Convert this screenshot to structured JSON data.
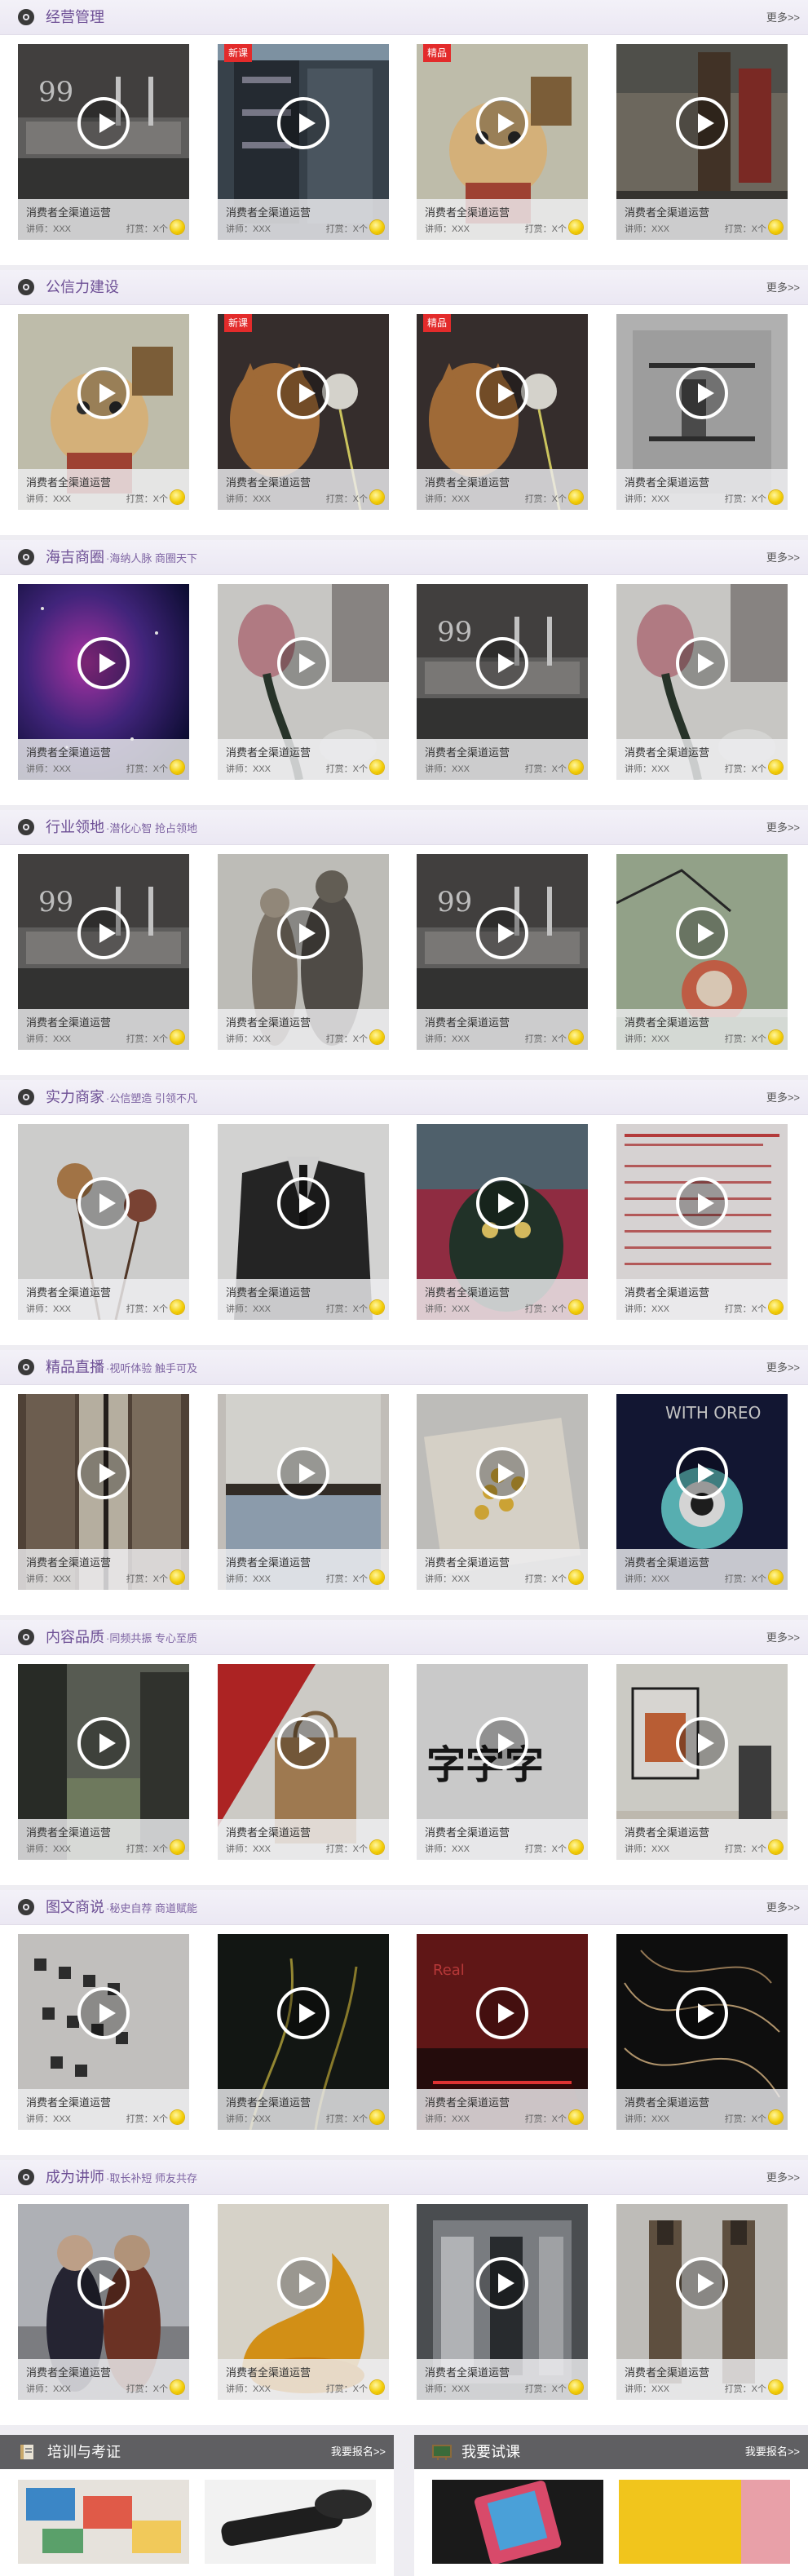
{
  "sections": [
    {
      "title": "经营管理",
      "subtitle": "",
      "more": "更多>>",
      "cards": [
        {
          "title": "消费者全渠道运营",
          "lecturer": "讲师：XXX",
          "tip": "打赏：X个",
          "tag": "",
          "theme": "interior"
        },
        {
          "title": "消费者全渠道运营",
          "lecturer": "讲师：XXX",
          "tip": "打赏：X个",
          "tag": "新课",
          "theme": "building"
        },
        {
          "title": "消费者全渠道运营",
          "lecturer": "讲师：XXX",
          "tip": "打赏：X个",
          "tag": "精品",
          "theme": "cartoon"
        },
        {
          "title": "消费者全渠道运营",
          "lecturer": "讲师：XXX",
          "tip": "打赏：X个",
          "tag": "",
          "theme": "ruin"
        }
      ]
    },
    {
      "title": "公信力建设",
      "subtitle": "",
      "more": "更多>>",
      "cards": [
        {
          "title": "消费者全渠道运营",
          "lecturer": "讲师：XXX",
          "tip": "打赏：X个",
          "tag": "",
          "theme": "cartoon"
        },
        {
          "title": "消费者全渠道运营",
          "lecturer": "讲师：XXX",
          "tip": "打赏：X个",
          "tag": "新课",
          "theme": "cat"
        },
        {
          "title": "消费者全渠道运营",
          "lecturer": "讲师：XXX",
          "tip": "打赏：X个",
          "tag": "精品",
          "theme": "cat"
        },
        {
          "title": "消费者全渠道运营",
          "lecturer": "讲师：XXX",
          "tip": "打赏：X个",
          "tag": "",
          "theme": "shelf"
        }
      ]
    },
    {
      "title": "海吉商圈",
      "subtitle": "·海纳人脉 商圈天下",
      "more": "更多>>",
      "cards": [
        {
          "title": "消费者全渠道运营",
          "lecturer": "讲师：XXX",
          "tip": "打赏：X个",
          "tag": "",
          "theme": "galaxy"
        },
        {
          "title": "消费者全渠道运营",
          "lecturer": "讲师：XXX",
          "tip": "打赏：X个",
          "tag": "",
          "theme": "floral"
        },
        {
          "title": "消费者全渠道运营",
          "lecturer": "讲师：XXX",
          "tip": "打赏：X个",
          "tag": "",
          "theme": "interior"
        },
        {
          "title": "消费者全渠道运营",
          "lecturer": "讲师：XXX",
          "tip": "打赏：X个",
          "tag": "",
          "theme": "floral"
        }
      ]
    },
    {
      "title": "行业领地",
      "subtitle": "·潜化心智 抢占领地",
      "more": "更多>>",
      "cards": [
        {
          "title": "消费者全渠道运营",
          "lecturer": "讲师：XXX",
          "tip": "打赏：X个",
          "tag": "",
          "theme": "interior"
        },
        {
          "title": "消费者全渠道运营",
          "lecturer": "讲师：XXX",
          "tip": "打赏：X个",
          "tag": "",
          "theme": "figures"
        },
        {
          "title": "消费者全渠道运营",
          "lecturer": "讲师：XXX",
          "tip": "打赏：X个",
          "tag": "",
          "theme": "interior"
        },
        {
          "title": "消费者全渠道运营",
          "lecturer": "讲师：XXX",
          "tip": "打赏：X个",
          "tag": "",
          "theme": "green"
        }
      ]
    },
    {
      "title": "实力商家",
      "subtitle": "·公信塑造 引领不凡",
      "more": "更多>>",
      "cards": [
        {
          "title": "消费者全渠道运营",
          "lecturer": "讲师：XXX",
          "tip": "打赏：X个",
          "tag": "",
          "theme": "flower"
        },
        {
          "title": "消费者全渠道运营",
          "lecturer": "讲师：XXX",
          "tip": "打赏：X个",
          "tag": "",
          "theme": "suit"
        },
        {
          "title": "消费者全渠道运营",
          "lecturer": "讲师：XXX",
          "tip": "打赏：X个",
          "tag": "",
          "theme": "monster"
        },
        {
          "title": "消费者全渠道运营",
          "lecturer": "讲师：XXX",
          "tip": "打赏：X个",
          "tag": "",
          "theme": "document"
        }
      ]
    },
    {
      "title": "精品直播",
      "subtitle": "·视听体验 触手可及",
      "more": "更多>>",
      "cards": [
        {
          "title": "消费者全渠道运营",
          "lecturer": "讲师：XXX",
          "tip": "打赏：X个",
          "tag": "",
          "theme": "screen"
        },
        {
          "title": "消费者全渠道运营",
          "lecturer": "讲师：XXX",
          "tip": "打赏：X个",
          "tag": "",
          "theme": "shirt"
        },
        {
          "title": "消费者全渠道运营",
          "lecturer": "讲师：XXX",
          "tip": "打赏：X个",
          "tag": "",
          "theme": "food"
        },
        {
          "title": "消费者全渠道运营",
          "lecturer": "讲师：XXX",
          "tip": "打赏：X个",
          "tag": "",
          "theme": "space"
        }
      ]
    },
    {
      "title": "内容品质",
      "subtitle": "·同频共振 专心至质",
      "more": "更多>>",
      "cards": [
        {
          "title": "消费者全渠道运营",
          "lecturer": "讲师：XXX",
          "tip": "打赏：X个",
          "tag": "",
          "theme": "signs"
        },
        {
          "title": "消费者全渠道运营",
          "lecturer": "讲师：XXX",
          "tip": "打赏：X个",
          "tag": "",
          "theme": "bag"
        },
        {
          "title": "消费者全渠道运营",
          "lecturer": "讲师：XXX",
          "tip": "打赏：X个",
          "tag": "",
          "theme": "calligraphy"
        },
        {
          "title": "消费者全渠道运营",
          "lecturer": "讲师：XXX",
          "tip": "打赏：X个",
          "tag": "",
          "theme": "room"
        }
      ]
    },
    {
      "title": "图文商说",
      "subtitle": "·秘史自荐 商道赋能",
      "more": "更多>>",
      "cards": [
        {
          "title": "消费者全渠道运营",
          "lecturer": "讲师：XXX",
          "tip": "打赏：X个",
          "tag": "",
          "theme": "paper"
        },
        {
          "title": "消费者全渠道运营",
          "lecturer": "讲师：XXX",
          "tip": "打赏：X个",
          "tag": "",
          "theme": "night"
        },
        {
          "title": "消费者全渠道运营",
          "lecturer": "讲师：XXX",
          "tip": "打赏：X个",
          "tag": "",
          "theme": "redlight"
        },
        {
          "title": "消费者全渠道运营",
          "lecturer": "讲师：XXX",
          "tip": "打赏：X个",
          "tag": "",
          "theme": "lines"
        }
      ]
    },
    {
      "title": "成为讲师",
      "subtitle": "·取长补短 师友共存",
      "more": "更多>>",
      "cards": [
        {
          "title": "消费者全渠道运营",
          "lecturer": "讲师：XXX",
          "tip": "打赏：X个",
          "tag": "",
          "theme": "couple"
        },
        {
          "title": "消费者全渠道运营",
          "lecturer": "讲师：XXX",
          "tip": "打赏：X个",
          "tag": "",
          "theme": "juice"
        },
        {
          "title": "消费者全渠道运营",
          "lecturer": "讲师：XXX",
          "tip": "打赏：X个",
          "tag": "",
          "theme": "store"
        },
        {
          "title": "消费者全渠道运营",
          "lecturer": "讲师：XXX",
          "tip": "打赏：X个",
          "tag": "",
          "theme": "bottles"
        }
      ]
    }
  ],
  "bottom": [
    {
      "title": "培训与考证",
      "more": "我要报名>>",
      "icon": "book-icon",
      "thumbs": [
        "art",
        "device"
      ]
    },
    {
      "title": "我要试课",
      "more": "我要报名>>",
      "icon": "blackboard-icon",
      "thumbs": [
        "phone",
        "yellow"
      ]
    }
  ],
  "colors": {
    "accent": "#6d4f95",
    "tag": "#e32b2b",
    "coin": "#f2cc00",
    "panel_head": "#5f5f62"
  }
}
